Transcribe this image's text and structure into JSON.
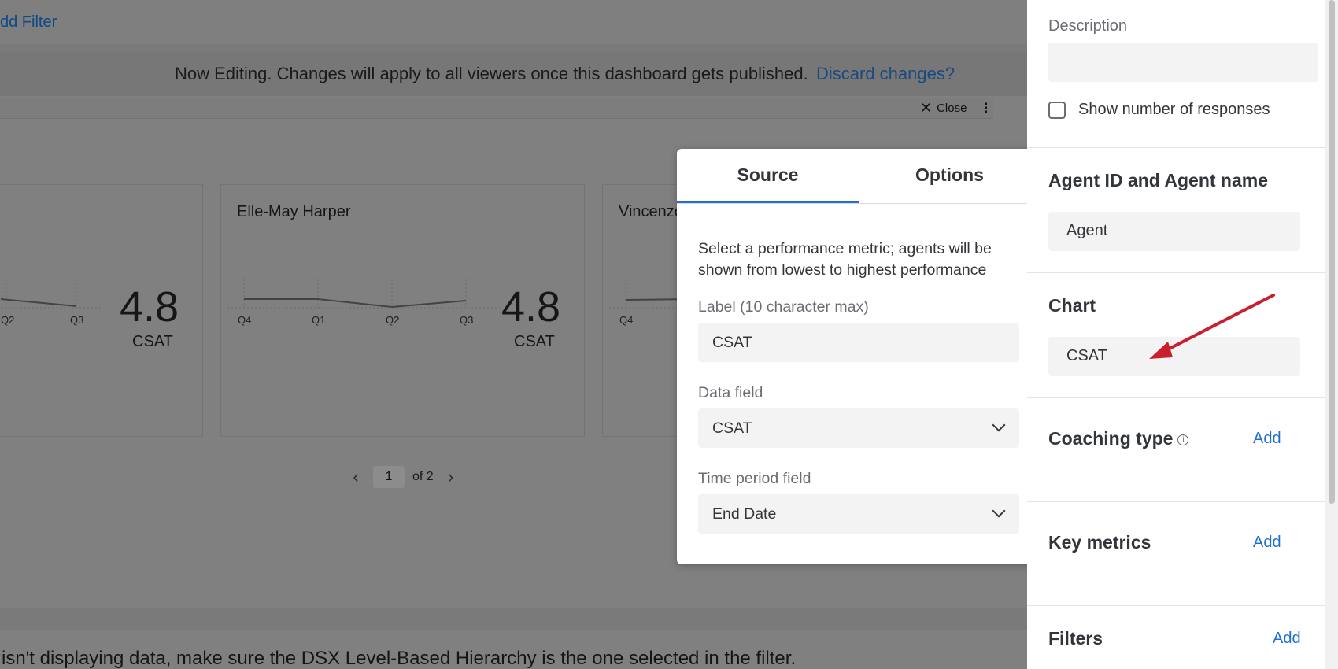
{
  "background": {
    "add_filter": "dd Filter",
    "editing_message": "Now Editing. Changes will apply to all viewers once this dashboard gets published.",
    "discard_link": "Discard changes?",
    "widget": {
      "close_label": "Close",
      "kebab": "⋮"
    },
    "cards": [
      {
        "name": "",
        "value": "4.8",
        "metric": "CSAT",
        "quarters": [
          "Q2",
          "Q3"
        ]
      },
      {
        "name": "Elle-May Harper",
        "value": "4.8",
        "metric": "CSAT",
        "quarters": [
          "Q4",
          "Q1",
          "Q2",
          "Q3"
        ]
      },
      {
        "name": "Vincenzo",
        "value": "",
        "metric": "",
        "quarters": [
          "Q4"
        ]
      }
    ],
    "pager": {
      "prev": "‹",
      "page": "1",
      "of": "of 2",
      "next": "›"
    },
    "help_text": "isn't displaying data, make sure the DSX Level-Based Hierarchy is the one selected in the filter."
  },
  "popover": {
    "tabs": [
      {
        "label": "Source",
        "active": true
      },
      {
        "label": "Options",
        "active": false
      }
    ],
    "description": "Select a performance metric; agents will be shown from lowest to highest performance",
    "label_field": {
      "label": "Label (10 character max)",
      "value": "CSAT"
    },
    "data_field": {
      "label": "Data field",
      "value": "CSAT"
    },
    "time_field": {
      "label": "Time period field",
      "value": "End Date"
    }
  },
  "panel": {
    "description_label": "Description",
    "description_value": "",
    "show_responses_label": "Show number of responses",
    "show_responses_checked": false,
    "agent_heading": "Agent ID and Agent name",
    "agent_value": "Agent",
    "chart_heading": "Chart",
    "chart_value": "CSAT",
    "coaching_heading": "Coaching type",
    "coaching_add": "Add",
    "key_metrics_heading": "Key metrics",
    "key_metrics_add": "Add",
    "filters_heading": "Filters",
    "filters_add": "Add"
  },
  "colors": {
    "accent": "#1f6fd1",
    "annotation_arrow": "#c8202f",
    "overlay": "#808080"
  }
}
